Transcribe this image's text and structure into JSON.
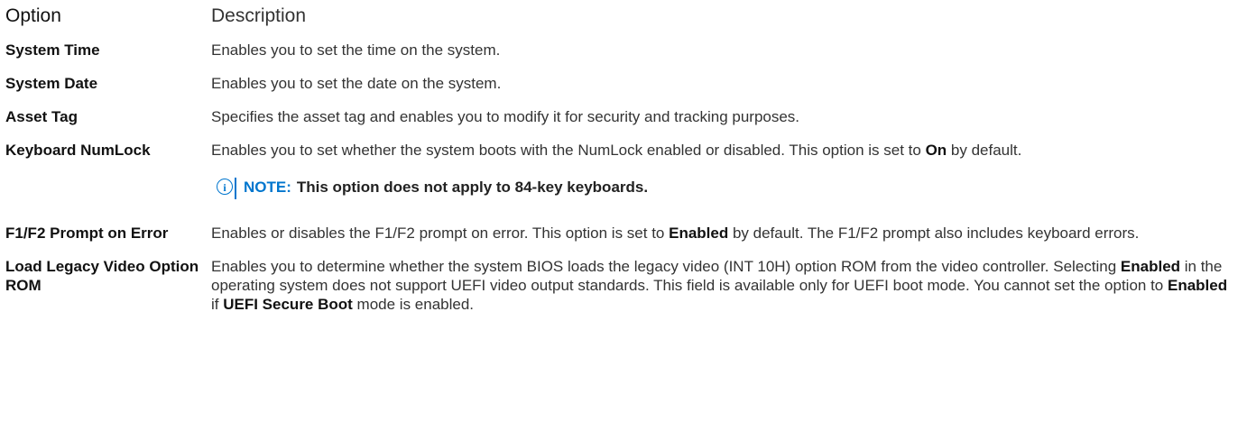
{
  "header": {
    "option": "Option",
    "description": "Description"
  },
  "rows": [
    {
      "option": "System Time",
      "desc": "Enables you to set the time on the system."
    },
    {
      "option": "System Date",
      "desc": "Enables you to set the date on the system."
    },
    {
      "option": "Asset Tag",
      "desc": "Specifies the asset tag and enables you to modify it for security and tracking purposes."
    },
    {
      "option": "Keyboard NumLock",
      "desc_a": "Enables you to set whether the system boots with the NumLock enabled or disabled. This option is set to ",
      "desc_kw": "On",
      "desc_b": " by default.",
      "note_label": "NOTE:",
      "note_text": "This option does not apply to 84-key keyboards."
    },
    {
      "option": "F1/F2 Prompt on Error",
      "desc_a": "Enables or disables the F1/F2 prompt on error. This option is set to ",
      "desc_kw": "Enabled",
      "desc_b": " by default. The F1/F2 prompt also includes keyboard errors."
    },
    {
      "option": "Load Legacy Video Option ROM",
      "desc_a": "Enables you to determine whether the system BIOS loads the legacy video (INT 10H) option ROM from the video controller. Selecting ",
      "desc_kw1": "Enabled",
      "desc_b": " in the operating system does not support UEFI video output standards. This field is available only for UEFI boot mode. You cannot set the option to ",
      "desc_kw2": "Enabled",
      "desc_c": " if ",
      "desc_kw3": "UEFI Secure Boot",
      "desc_d": " mode is enabled."
    }
  ],
  "icons": {
    "note": "info-icon"
  },
  "colors": {
    "note_accent": "#0076ce"
  }
}
